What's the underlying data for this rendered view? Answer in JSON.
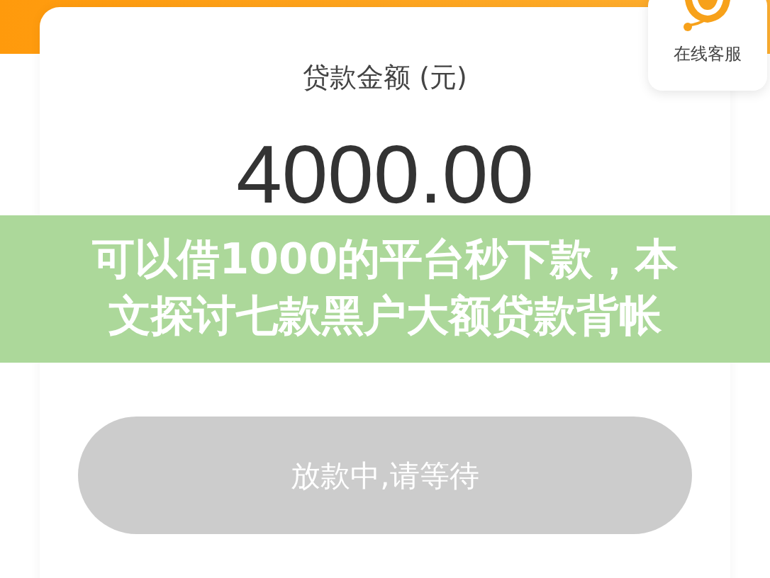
{
  "support": {
    "label": "在线客服"
  },
  "loan": {
    "label": "贷款金额 (元)",
    "amount": "4000.00"
  },
  "action_button": {
    "label": "放款中,请等待",
    "disabled": true
  },
  "caption_banner": {
    "lines": [
      "可以借1000的平台秒下款，本",
      "文探讨七款黑户大额贷款背帐"
    ]
  }
}
